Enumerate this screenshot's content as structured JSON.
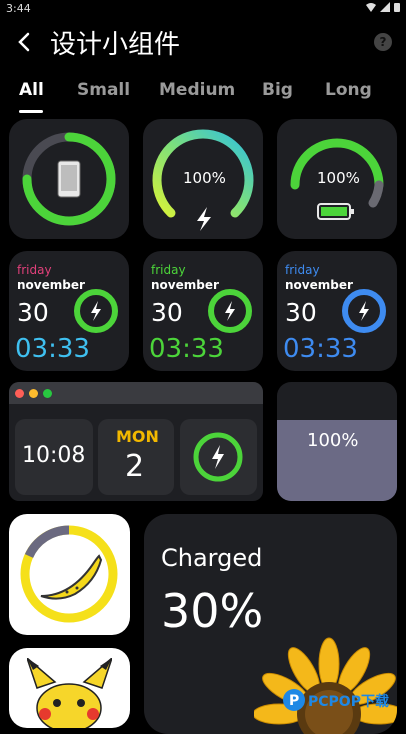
{
  "status": {
    "time": "3:44"
  },
  "header": {
    "title": "设计小组件",
    "help": "?"
  },
  "tabs": [
    "All",
    "Small",
    "Medium",
    "Big",
    "Long"
  ],
  "widgets": {
    "ring2": {
      "percent": "100%"
    },
    "ring3": {
      "percent": "100%"
    },
    "date1": {
      "weekday": "friday",
      "month": "november",
      "day": "30",
      "time": "03:33",
      "accent": "#e0407a",
      "time_color": "#3fc0f0"
    },
    "date2": {
      "weekday": "friday",
      "month": "november",
      "day": "30",
      "time": "03:33",
      "accent": "#4cd43a",
      "time_color": "#4cd43a"
    },
    "date3": {
      "weekday": "friday",
      "month": "november",
      "day": "30",
      "time": "03:33",
      "accent": "#3e8bf0",
      "time_color": "#3e8bf0"
    },
    "medium": {
      "clock": "10:08",
      "month": "MON",
      "day": "2"
    },
    "tall_pct": "100%",
    "big": {
      "title": "Charged",
      "percent": "30%"
    }
  },
  "watermark": "PCPOP下载"
}
